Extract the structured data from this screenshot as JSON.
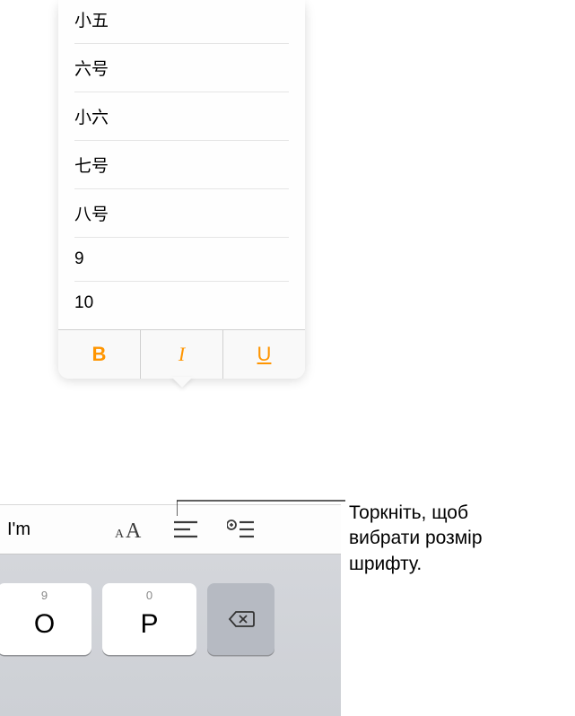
{
  "popover": {
    "sizes": [
      "小五",
      "六号",
      "小六",
      "七号",
      "八号",
      "9",
      "10"
    ],
    "styles": {
      "bold": "B",
      "italic": "I",
      "underline": "U"
    }
  },
  "toolbar": {
    "suggestion": "I'm"
  },
  "keyboard": {
    "keys": [
      {
        "secondary": "9",
        "primary": "O"
      },
      {
        "secondary": "0",
        "primary": "P"
      }
    ]
  },
  "callout": {
    "line1": "Торкніть, щоб",
    "line2": "вибрати розмір",
    "line3": "шрифту."
  }
}
